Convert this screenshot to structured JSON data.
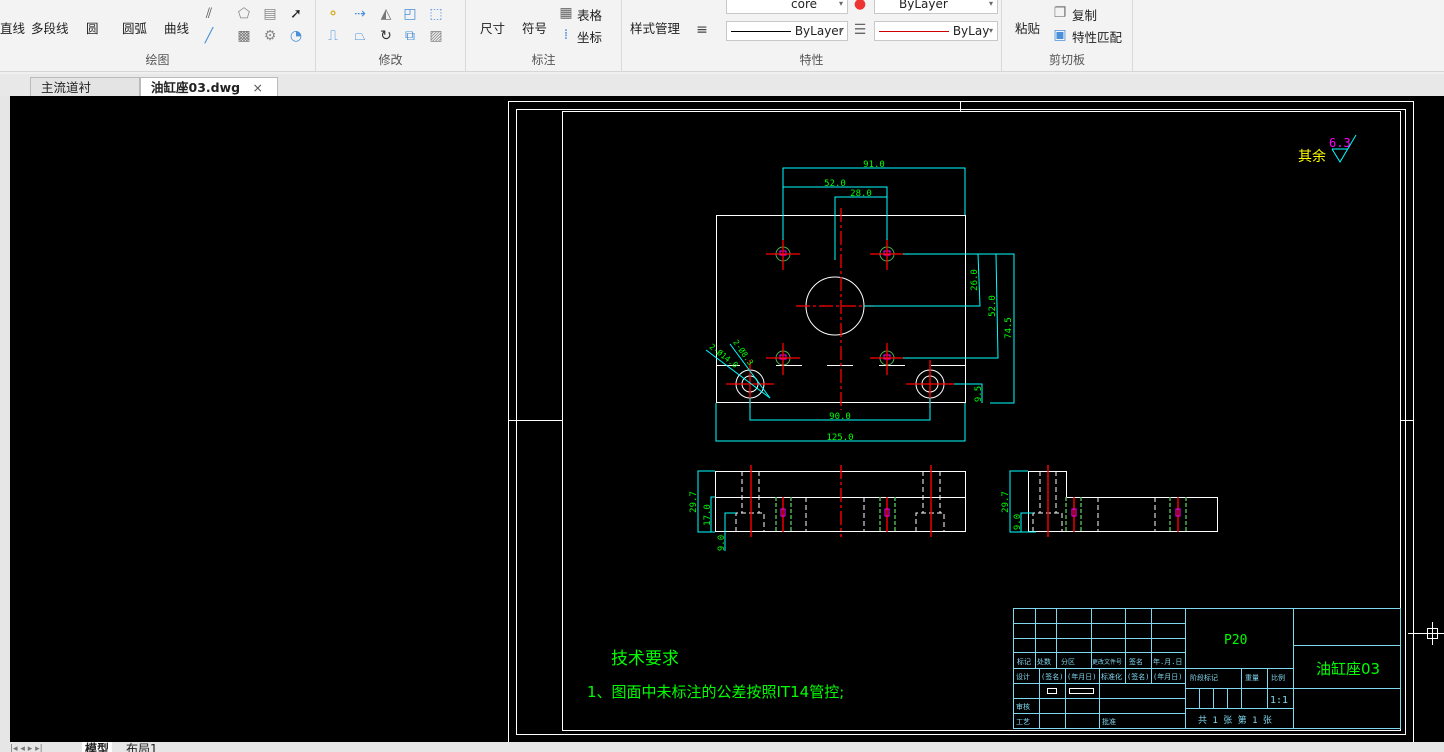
{
  "ribbon": {
    "draw": {
      "label": "绘图",
      "tools": [
        "直线",
        "多段线",
        "圆",
        "圆弧",
        "曲线"
      ]
    },
    "modify": {
      "label": "修改"
    },
    "annotate": {
      "label": "标注",
      "tools": [
        "尺寸",
        "符号",
        "表格",
        "坐标"
      ]
    },
    "properties": {
      "label": "特性",
      "style_manager": "样式管理",
      "layer_value": "core",
      "color_value": "ByLayer",
      "linetype_value": "ByLayer",
      "lineweight_value": "ByLay"
    },
    "clipboard": {
      "label": "剪切板",
      "paste": "粘贴",
      "copy": "复制",
      "match_properties": "特性匹配"
    }
  },
  "tabs": [
    {
      "label": "主流道衬套.dwg"
    },
    {
      "label": "油缸座03.dwg",
      "active": true
    }
  ],
  "close_icon": "×",
  "layout_tabs": [
    "模型",
    "布局1"
  ],
  "drawing": {
    "dims": {
      "d91": "91.0",
      "d52h": "52.0",
      "d28": "28.0",
      "d125": "125.0",
      "d90": "90.0",
      "d26": "26.0",
      "d52v": "52.0",
      "d745": "74.5",
      "d95": "9.5",
      "d297a": "29.7",
      "d170": "17.0",
      "d90b": "9.0",
      "d297b": "29.7",
      "d90c": "9.0",
      "hole1": "2-Ø14.0",
      "hole2": "2-Ø8.3"
    },
    "roughness_label": "其余",
    "roughness_value": "6.3",
    "tech_title": "技术要求",
    "tech_note": "1、图面中未标注的公差按照IT14管控;",
    "title_block": {
      "material": "P20",
      "part_name": "油缸座03",
      "scale": "1:1",
      "row1": [
        "标记",
        "处数",
        "分区",
        "更改文件号",
        "签名",
        "年.月.日"
      ],
      "row2": [
        "设计",
        "(签名)",
        "(年月日)",
        "标准化",
        "(签名)",
        "(年月日)"
      ],
      "stage": [
        "阶段标记",
        "重量",
        "比例"
      ],
      "audit": "审核",
      "craft": "工艺",
      "approve": "批准",
      "sheets": "共 1 张   第 1 张"
    }
  },
  "colors": {
    "canvas": "#000000",
    "dim": "#00ffff",
    "text": "#00ff00",
    "center": "#ff0000",
    "outline": "#ffffff",
    "frame": "#80d8f0"
  }
}
